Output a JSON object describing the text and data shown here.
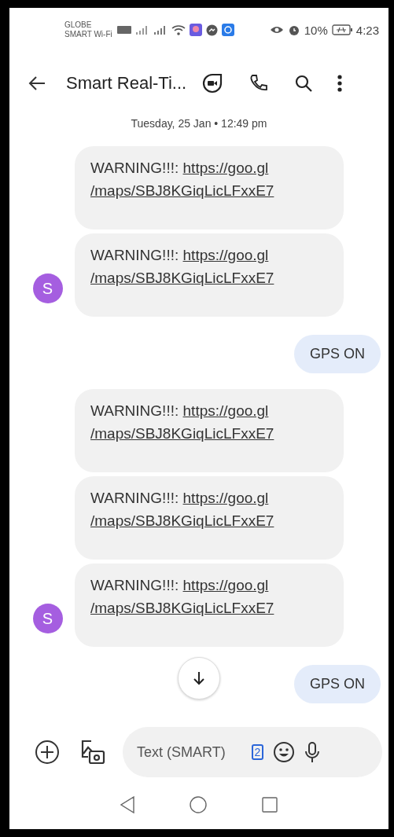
{
  "status_bar": {
    "carrier_lines": [
      "GLOBE",
      "SMART Wi-Fi"
    ],
    "battery_percent": "10%",
    "time": "4:23"
  },
  "toolbar": {
    "title": "Smart Real-Ti..."
  },
  "date_divider": "Tuesday, 25 Jan • 12:49 pm",
  "messages": [
    {
      "kind": "incoming",
      "prefix": "WARNING!!!: ",
      "link_lines": [
        "https://goo.gl",
        "/maps/SBJ8KGiqLicLFxxE7"
      ]
    },
    {
      "kind": "incoming",
      "prefix": "WARNING!!!: ",
      "link_lines": [
        "https://goo.gl",
        "/maps/SBJ8KGiqLicLFxxE7"
      ],
      "avatar": "S"
    },
    {
      "kind": "outgoing",
      "text": "GPS ON"
    },
    {
      "kind": "incoming",
      "prefix": "WARNING!!!: ",
      "link_lines": [
        "https://goo.gl",
        "/maps/SBJ8KGiqLicLFxxE7"
      ]
    },
    {
      "kind": "incoming",
      "prefix": "WARNING!!!: ",
      "link_lines": [
        "https://goo.gl",
        "/maps/SBJ8KGiqLicLFxxE7"
      ]
    },
    {
      "kind": "incoming",
      "prefix": "WARNING!!!: ",
      "link_lines": [
        "https://goo.gl",
        "/maps/SBJ8KGiqLicLFxxE7"
      ],
      "avatar": "S"
    },
    {
      "kind": "outgoing",
      "text": "GPS ON",
      "scroll_button": true
    }
  ],
  "compose": {
    "placeholder": "Text (SMART)",
    "sim": "2"
  }
}
